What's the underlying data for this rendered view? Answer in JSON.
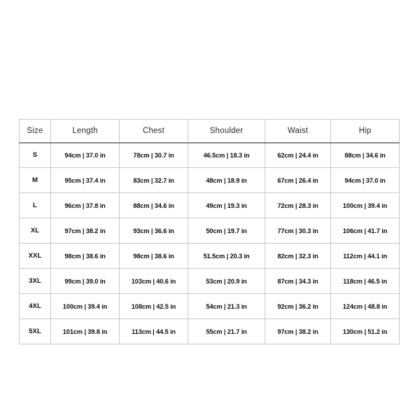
{
  "table": {
    "name": "size-chart",
    "columns": [
      "Size",
      "Length",
      "Chest",
      "Shoulder",
      "Waist",
      "Hip"
    ],
    "rows": [
      {
        "size": "S",
        "length": "94cm | 37.0 in",
        "chest": "78cm | 30.7 in",
        "shoulder": "46.5cm | 18.3 in",
        "waist": "62cm | 24.4 in",
        "hip": "88cm | 34.6 in"
      },
      {
        "size": "M",
        "length": "95cm | 37.4 in",
        "chest": "83cm | 32.7 in",
        "shoulder": "48cm | 18.9 in",
        "waist": "67cm | 26.4 in",
        "hip": "94cm | 37.0 in"
      },
      {
        "size": "L",
        "length": "96cm | 37.8 in",
        "chest": "88cm | 34.6 in",
        "shoulder": "49cm | 19.3 in",
        "waist": "72cm | 28.3 in",
        "hip": "100cm | 39.4 in"
      },
      {
        "size": "XL",
        "length": "97cm | 38.2 in",
        "chest": "93cm | 36.6 in",
        "shoulder": "50cm | 19.7 in",
        "waist": "77cm | 30.3 in",
        "hip": "106cm | 41.7 in"
      },
      {
        "size": "XXL",
        "length": "98cm | 38.6 in",
        "chest": "98cm | 38.6 in",
        "shoulder": "51.5cm | 20.3 in",
        "waist": "82cm | 32.3 in",
        "hip": "112cm | 44.1 in"
      },
      {
        "size": "3XL",
        "length": "99cm | 39.0 in",
        "chest": "103cm | 40.6 in",
        "shoulder": "53cm | 20.9 in",
        "waist": "87cm | 34.3 in",
        "hip": "118cm | 46.5 in"
      },
      {
        "size": "4XL",
        "length": "100cm | 39.4 in",
        "chest": "108cm | 42.5 in",
        "shoulder": "54cm | 21.3 in",
        "waist": "92cm | 36.2 in",
        "hip": "124cm | 48.8 in"
      },
      {
        "size": "5XL",
        "length": "101cm | 39.8 in",
        "chest": "113cm | 44.5 in",
        "shoulder": "55cm | 21.7 in",
        "waist": "97cm | 38.2 in",
        "hip": "130cm | 51.2 in"
      }
    ]
  },
  "colors": {
    "background": "#ffffff",
    "grid_line": "#c8c8c8",
    "header_rule": "#8a8a8a",
    "header_text": "#2b2b2b",
    "cell_text": "#0d0d0d"
  }
}
